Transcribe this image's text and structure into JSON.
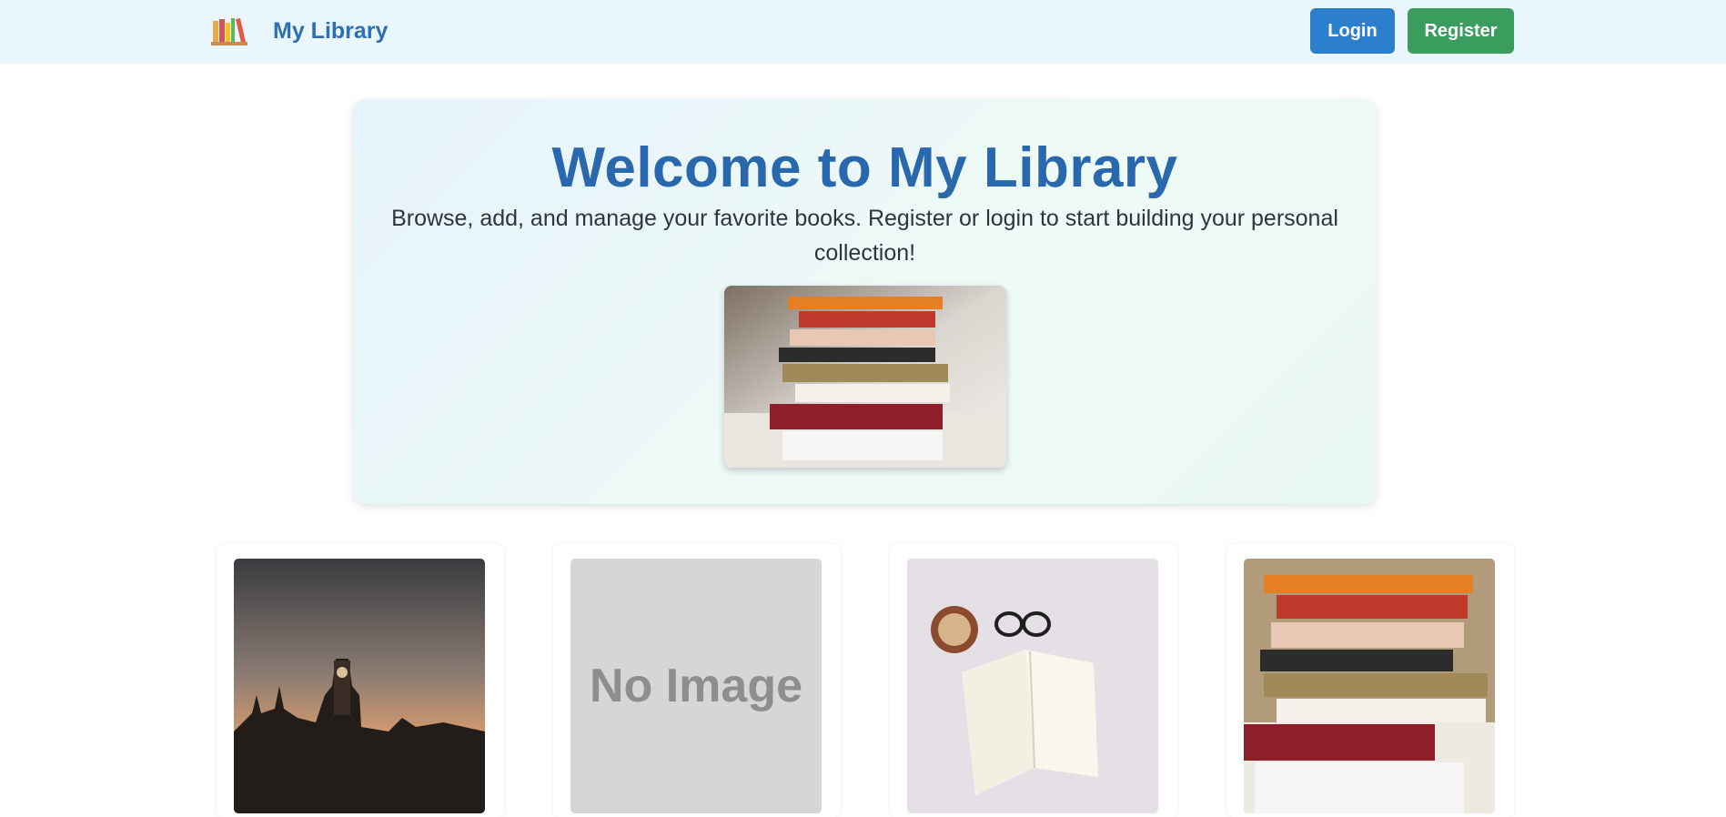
{
  "navbar": {
    "brand_title": "My Library",
    "logo_icon": "books-icon",
    "login_label": "Login",
    "register_label": "Register",
    "colors": {
      "background": "#e9f6fc",
      "brand": "#2d6fb3",
      "login": "#2b7fcd",
      "register": "#3a9d5d"
    }
  },
  "hero": {
    "title": "Welcome to My Library",
    "subtitle": "Browse, add, and manage your favorite books. Register or login to start building your personal collection!",
    "image_icon": "book-stack-image"
  },
  "books": [
    {
      "cover": "london-skyline-image"
    },
    {
      "cover": "no-image-placeholder",
      "placeholder_text": "No Image"
    },
    {
      "cover": "open-book-coffee-image"
    },
    {
      "cover": "book-stack-image"
    }
  ]
}
